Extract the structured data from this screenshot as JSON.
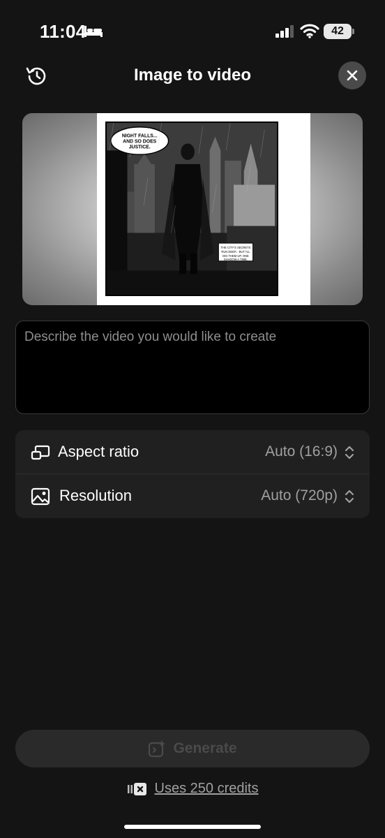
{
  "status": {
    "time": "11:04",
    "battery": "42"
  },
  "header": {
    "title": "Image to video"
  },
  "preview": {
    "speech_bubble": "NIGHT FALLS... AND SO DOES JUSTICE.",
    "caption_box": "THE CITY'S SECRETS RUN DEEP... BUT I'LL DIG THEM UP, ONE SHADOW A TIME."
  },
  "prompt": {
    "placeholder": "Describe the video you would like to create",
    "value": ""
  },
  "settings": {
    "aspect_ratio": {
      "label": "Aspect ratio",
      "value": "Auto (16:9)"
    },
    "resolution": {
      "label": "Resolution",
      "value": "Auto (720p)"
    }
  },
  "generate": {
    "label": "Generate"
  },
  "credits": {
    "text": "Uses 250 credits"
  },
  "colors": {
    "background": "#141414",
    "card": "#202020",
    "muted_text": "#a0a0a0"
  }
}
